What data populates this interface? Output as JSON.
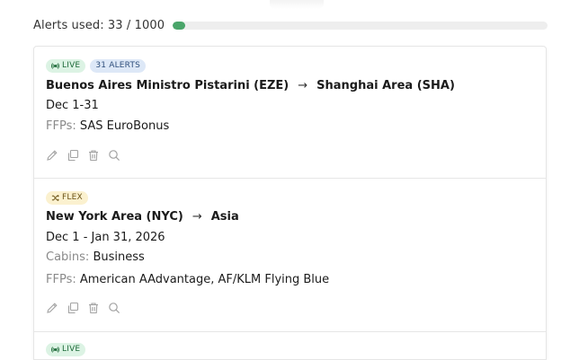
{
  "usage": {
    "label": "Alerts used: 33 / 1000",
    "used": 33,
    "limit": 1000,
    "fill_fraction": 0.033,
    "bar_color": "#4aa56a"
  },
  "alerts": [
    {
      "badges": [
        {
          "type": "live",
          "label": "LIVE",
          "icon": "live-broadcast-icon"
        },
        {
          "type": "count",
          "label": "31 ALERTS"
        }
      ],
      "origin": "Buenos Aires Ministro Pistarini (EZE)",
      "destination": "Shanghai Area (SHA)",
      "dates": "Dec 1-31",
      "ffps_label": "FFPs:",
      "ffps_value": "SAS EuroBonus"
    },
    {
      "badges": [
        {
          "type": "flex",
          "label": "FLEX",
          "icon": "shuffle-icon"
        }
      ],
      "origin": "New York Area (NYC)",
      "destination": "Asia",
      "dates": "Dec 1 - Jan 31, 2026",
      "cabins_label": "Cabins:",
      "cabins_value": "Business",
      "ffps_label": "FFPs:",
      "ffps_value": "American AAdvantage, AF/KLM Flying Blue"
    },
    {
      "badges": [
        {
          "type": "live",
          "label": "LIVE",
          "icon": "live-broadcast-icon"
        }
      ]
    }
  ],
  "actions": [
    "edit-icon",
    "duplicate-icon",
    "delete-icon",
    "search-icon"
  ],
  "arrow_glyph": "→"
}
